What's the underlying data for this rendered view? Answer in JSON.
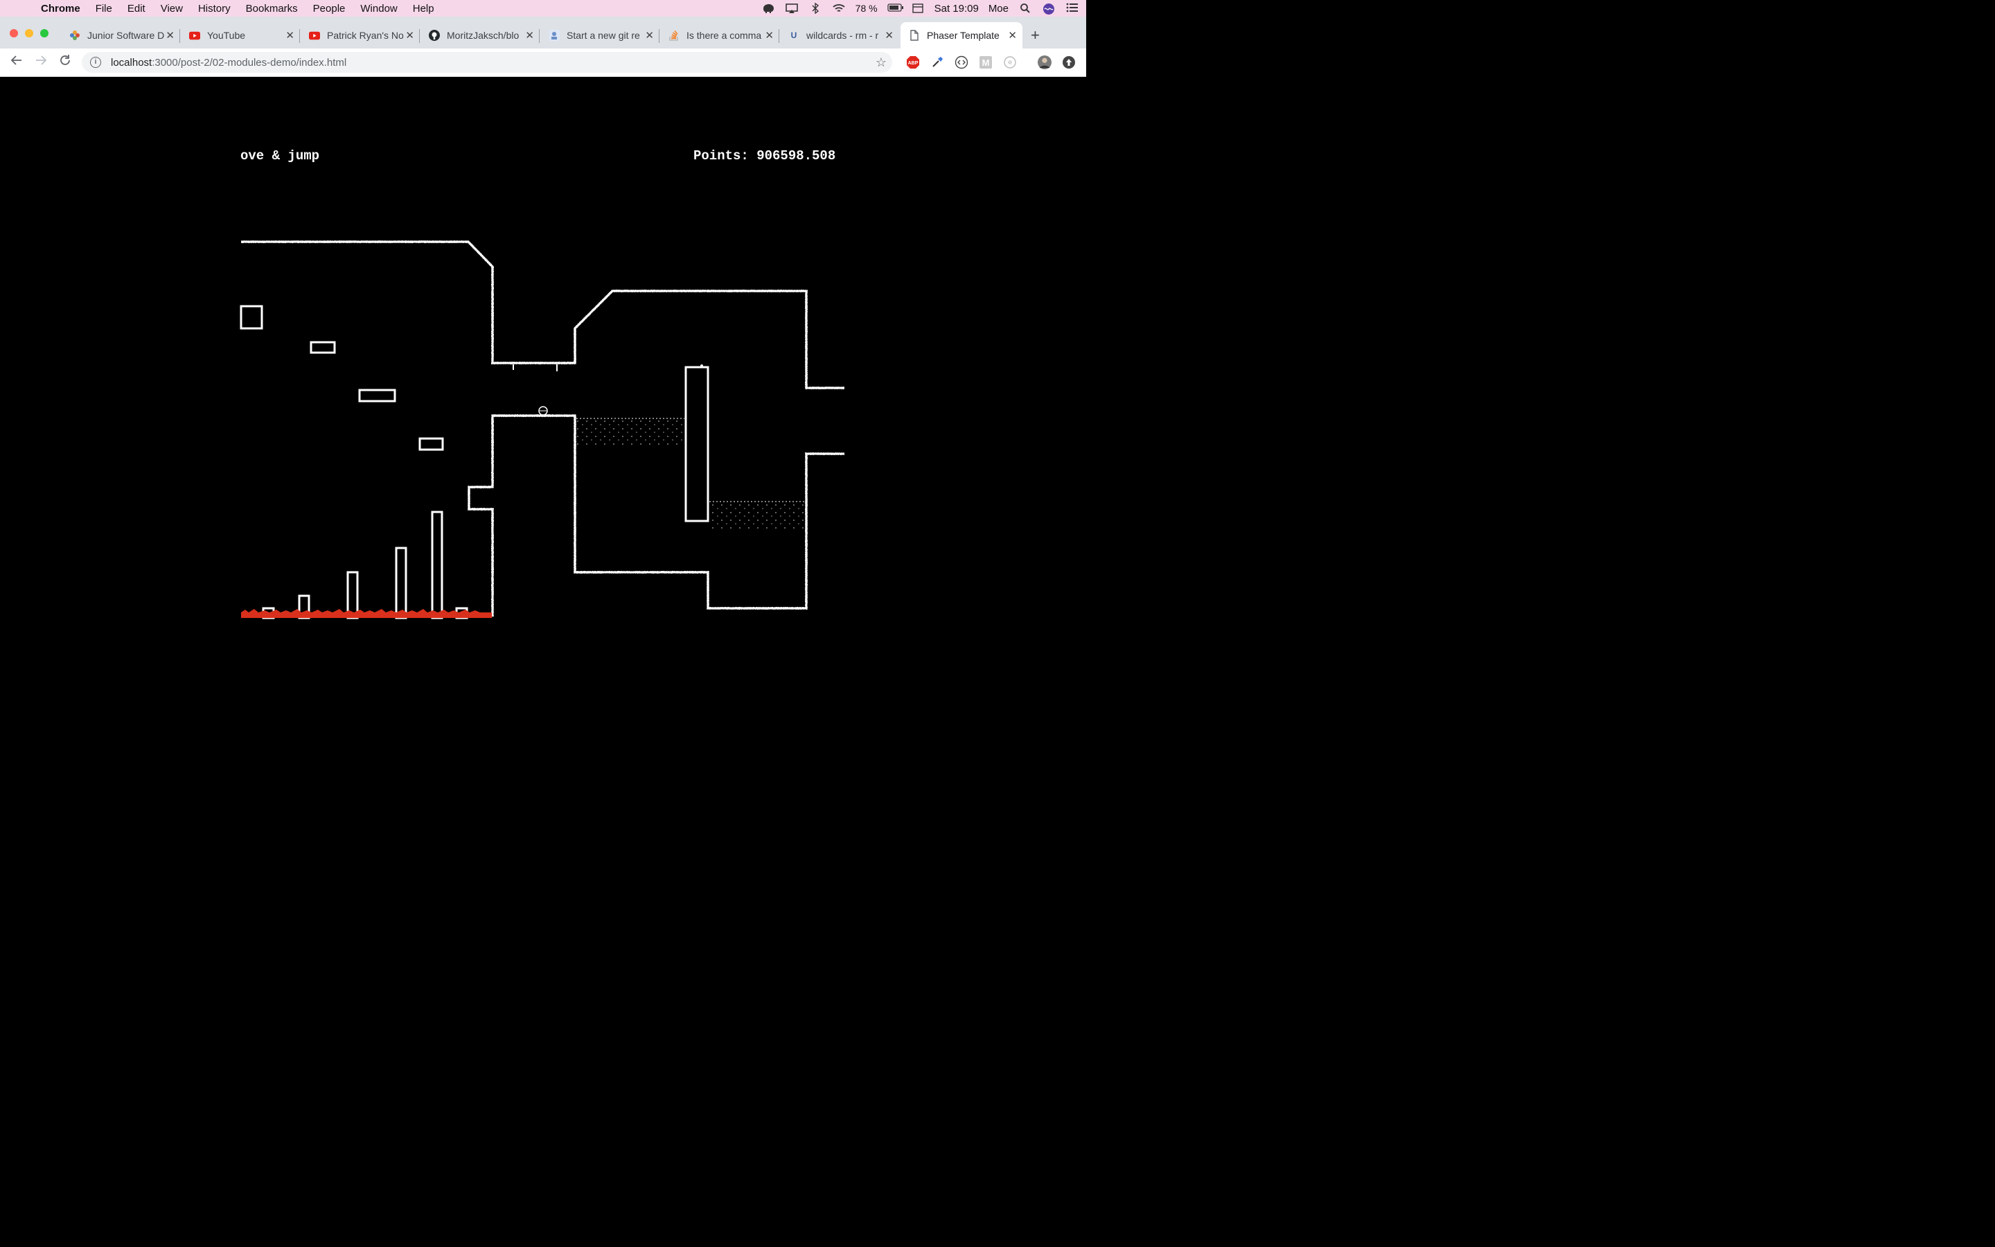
{
  "menubar": {
    "app": "Chrome",
    "items": [
      "File",
      "Edit",
      "View",
      "History",
      "Bookmarks",
      "People",
      "Window",
      "Help"
    ],
    "battery": "78 %",
    "clock": "Sat 19:09",
    "user": "Moe"
  },
  "tabs": [
    {
      "label": "Junior Software D",
      "icon": "pinwheel-icon",
      "color": "#e8a030"
    },
    {
      "label": "YouTube",
      "icon": "youtube-icon",
      "color": "#e62117"
    },
    {
      "label": "Patrick Ryan's No",
      "icon": "youtube-icon",
      "color": "#e62117"
    },
    {
      "label": "MoritzJaksch/blo",
      "icon": "github-icon",
      "color": "#24292e"
    },
    {
      "label": "Start a new git re",
      "icon": "blog-icon",
      "color": "#6b8fc7"
    },
    {
      "label": "Is there a comma",
      "icon": "stackoverflow-icon",
      "color": "#f48024"
    },
    {
      "label": "wildcards - rm - r",
      "icon": "unix-linux-icon",
      "color": "#3a5a9f"
    },
    {
      "label": "Phaser Template",
      "icon": "page-icon",
      "color": "#5f6368",
      "active": true
    }
  ],
  "omnibox": {
    "host": "localhost",
    "path": ":3000/post-2/02-modules-demo/index.html"
  },
  "extensions": [
    "adblock-plus-icon",
    "eyedropper-icon",
    "code-icon",
    "m-icon",
    "ghost-icon",
    "profile-avatar",
    "update-icon"
  ],
  "game": {
    "instructions": "ove & jump",
    "points_label": "Points: 906598.508",
    "colors": {
      "wall": "#ffffff",
      "lava": "#d8301c",
      "background": "#000000"
    }
  }
}
